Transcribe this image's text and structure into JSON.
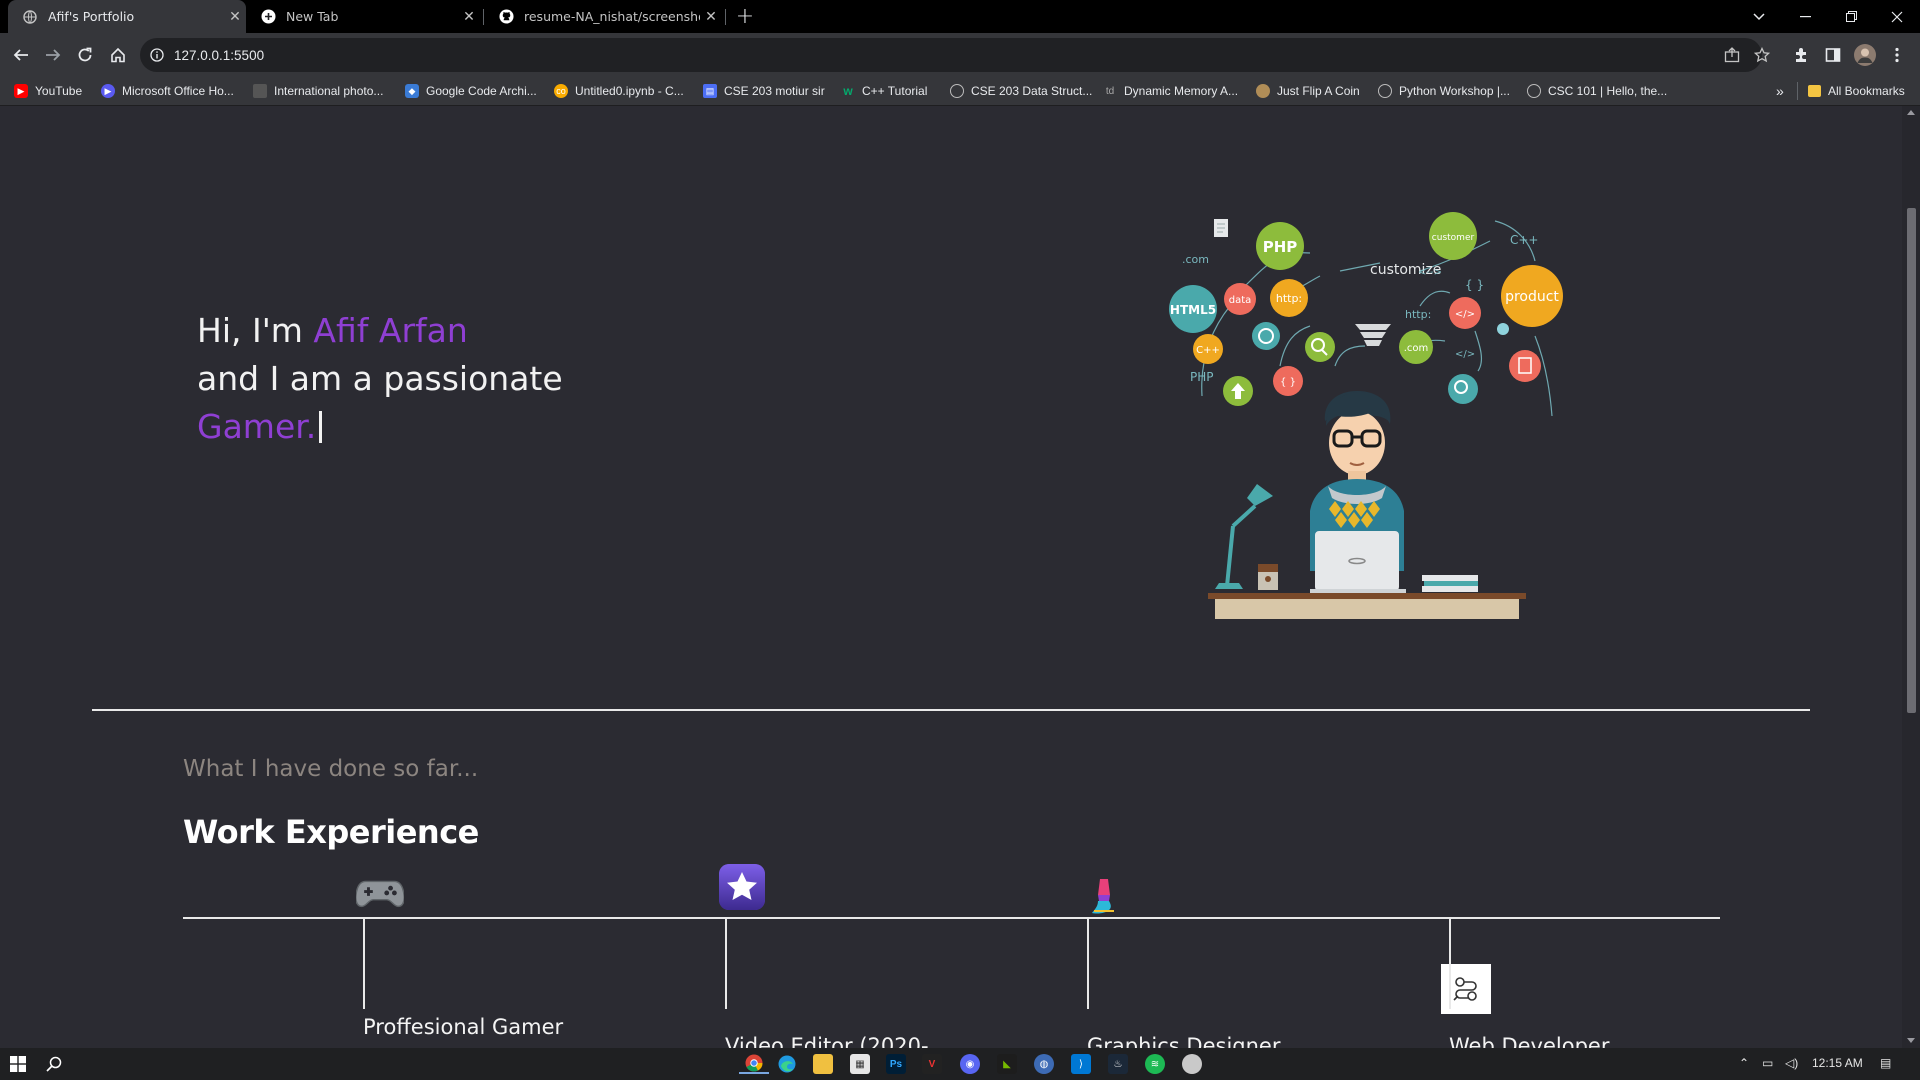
{
  "browser": {
    "tabs": [
      {
        "title": "Afif's Portfolio",
        "active": true
      },
      {
        "title": "New Tab",
        "active": false
      },
      {
        "title": "resume-NA_nishat/screenshot/S",
        "active": false
      }
    ],
    "new_tab_symbol": "+",
    "url": "127.0.0.1:5500",
    "bookmarks": [
      {
        "label": "YouTube",
        "icon": "youtube-icon",
        "color": "#ff0000"
      },
      {
        "label": "Microsoft Office Ho...",
        "icon": "office-icon",
        "color": "#5a5af0"
      },
      {
        "label": "International photo...",
        "icon": "photo-icon",
        "color": "#555555"
      },
      {
        "label": "Google Code Archi...",
        "icon": "google-code-icon",
        "color": "#3a7bd5"
      },
      {
        "label": "Untitled0.ipynb - C...",
        "icon": "colab-icon",
        "color": "#f9ab00"
      },
      {
        "label": "CSE 203 motiur sir",
        "icon": "classroom-icon",
        "color": "#4c6ef5"
      },
      {
        "label": "C++ Tutorial",
        "icon": "w3schools-icon",
        "color": "#04aa6d"
      },
      {
        "label": "CSE 203 Data Struct...",
        "icon": "globe-icon",
        "color": "#777777"
      },
      {
        "label": "Dynamic Memory A...",
        "icon": "td-icon",
        "color": "#666666"
      },
      {
        "label": "Just Flip A Coin",
        "icon": "coin-icon",
        "color": "#b08d57"
      },
      {
        "label": "Python Workshop |...",
        "icon": "globe-icon",
        "color": "#777777"
      },
      {
        "label": "CSC 101 | Hello, the...",
        "icon": "globe-icon",
        "color": "#777777"
      }
    ],
    "more_bookmarks": "»",
    "all_bookmarks": "All Bookmarks"
  },
  "hero": {
    "line1_prefix": "Hi, I'm ",
    "name": "Afif Arfan",
    "line2": "and I am a passionate",
    "role": "Gamer."
  },
  "illustration": {
    "php": "PHP",
    "customer": "customer",
    "cpp_top": "C++",
    "customize": "customize",
    "product": "product",
    "html5": "HTML5",
    "data": "data",
    "http1": "http:",
    "http2": "http:",
    "dotcom1": ".com",
    "dotcom2": ".com",
    "cpp_small": "C++",
    "php_small": "PHP",
    "code_tag1": "</>",
    "code_tag2": "</>",
    "braces1": "{ }",
    "braces2": "{ }",
    "arrows": "<-->"
  },
  "section": {
    "subtitle": "What I have done so far...",
    "title": "Work Experience"
  },
  "timeline": [
    {
      "label": "Proffesional Gamer",
      "icon": "gamepad-icon"
    },
    {
      "label": "Video Editor (2020-",
      "icon": "imovie-star-icon"
    },
    {
      "label": "Graphics Designer",
      "icon": "paint-brush-icon"
    },
    {
      "label": "Web Developer",
      "icon": "code-nodes-icon"
    }
  ],
  "taskbar": {
    "time": "12:15 AM"
  },
  "colors": {
    "accent": "#8f3fd3",
    "page_bg": "#2b2b32",
    "subtitle": "#8c8580"
  }
}
